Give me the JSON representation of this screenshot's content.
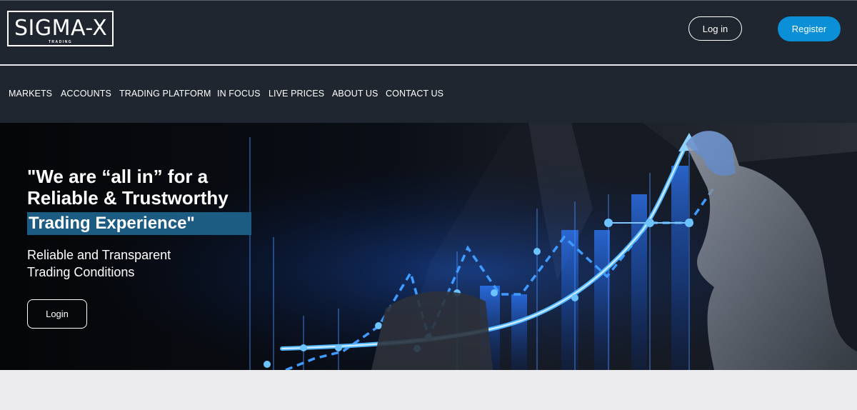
{
  "header": {
    "logo": {
      "name": "SIGMA-X",
      "tagline": "TRADING"
    },
    "login_label": "Log in",
    "register_label": "Register"
  },
  "nav": {
    "items": [
      {
        "label": "MARKETS"
      },
      {
        "label": "ACCOUNTS"
      },
      {
        "label": "TRADING PLATFORM"
      },
      {
        "label": "IN FOCUS"
      },
      {
        "label": "LIVE PRICES"
      },
      {
        "label": "ABOUT US"
      },
      {
        "label": "CONTACT US"
      }
    ]
  },
  "hero": {
    "title_line1": "\"We are “all in” for a",
    "title_line2": "Reliable & Trustworthy",
    "title_highlight": "Trading Experience\"",
    "subtitle_line1": "Reliable and Transparent",
    "subtitle_line2": "Trading Conditions",
    "login_label": "Login"
  },
  "colors": {
    "header_bg": "#1f2630",
    "register_button": "#0b8fd6",
    "highlight_bg": "#1c5b82",
    "hero_bg": "#07090e",
    "page_bg": "#ececee"
  }
}
